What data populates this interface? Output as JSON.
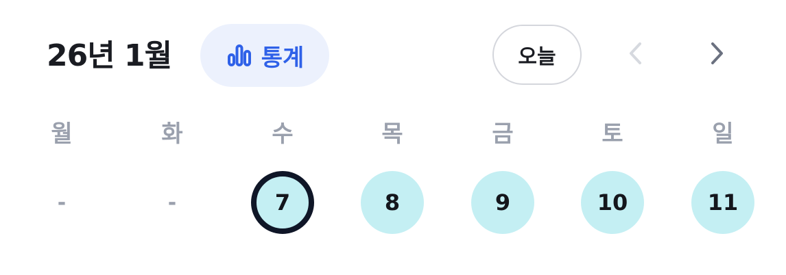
{
  "header": {
    "title": "26년 1월",
    "stats_label": "통계",
    "stats_icon": "bar-chart-icon",
    "today_label": "오늘",
    "prev_icon": "chevron-left-icon",
    "next_icon": "chevron-right-icon",
    "accent_color": "#2f61e8",
    "accent_bg": "#ecf1fd"
  },
  "weekdays": [
    "월",
    "화",
    "수",
    "목",
    "금",
    "토",
    "일"
  ],
  "days": [
    {
      "label": "-",
      "state": "empty"
    },
    {
      "label": "-",
      "state": "empty"
    },
    {
      "label": "7",
      "state": "selected"
    },
    {
      "label": "8",
      "state": "filled"
    },
    {
      "label": "9",
      "state": "filled"
    },
    {
      "label": "10",
      "state": "filled"
    },
    {
      "label": "11",
      "state": "filled"
    }
  ],
  "colors": {
    "day_fill": "#c4eff3",
    "selected_ring": "#0f1627",
    "weekday_text": "#9aa0ad"
  }
}
